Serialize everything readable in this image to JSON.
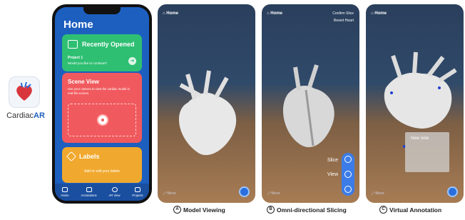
{
  "app": {
    "name_prefix": "Cardiac",
    "name_suffix": "AR",
    "icon": "heart-app-icon"
  },
  "phone": {
    "title": "Home",
    "recently_opened": {
      "label": "Recently Opened",
      "project": "Project 1",
      "prompt": "Would you like to continue?"
    },
    "scene_view": {
      "label": "Scene View",
      "description": "Use your camera to view the cardiac model in real-life scenes."
    },
    "labels": {
      "label": "Labels",
      "description": "Add or edit your labels"
    },
    "tabs": [
      "Home",
      "Annotations",
      "AR View",
      "Projects"
    ]
  },
  "views": {
    "v1": {
      "home": "Home",
      "move": "Move"
    },
    "v2": {
      "home": "Home",
      "confirm": "Confirm Slice",
      "revert": "Revert Heart",
      "slice": "Slice",
      "view": "View",
      "move": "Move"
    },
    "v3": {
      "home": "Home",
      "note": "New note",
      "move": "Move"
    }
  },
  "captions": [
    {
      "letter": "A",
      "text": "Model Viewing"
    },
    {
      "letter": "B",
      "text": "Omni-directional Slicing"
    },
    {
      "letter": "C",
      "text": "Virtual Annotation"
    }
  ],
  "colors": {
    "brand_blue": "#1c5fbf",
    "green": "#2fbf73",
    "red": "#f05a5e",
    "orange": "#f0a92e"
  }
}
